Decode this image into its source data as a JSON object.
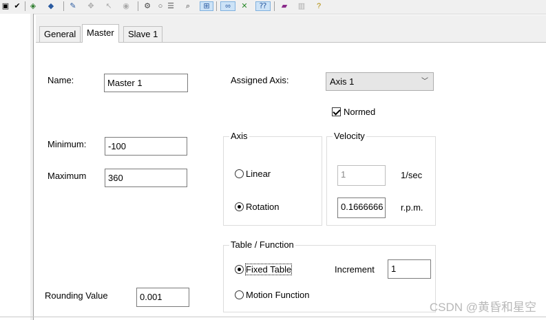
{
  "toolbar": {
    "icons": [
      "window-icon",
      "check-icon",
      "select-icon",
      "transform-icon",
      "edit-icon",
      "move-icon",
      "pointer-icon",
      "circle-icon",
      "node-icon",
      "zoom-icon",
      "network-icon",
      "list-icon",
      "view-icon",
      "axis-icon",
      "help-icon",
      "book-icon",
      "tools-icon",
      "info-icon"
    ]
  },
  "tabs": [
    "General",
    "Master",
    "Slave 1"
  ],
  "active_tab": "Master",
  "form": {
    "name_label": "Name:",
    "name_value": "Master 1",
    "minimum_label": "Minimum:",
    "minimum_value": "-100",
    "maximum_label": "Maximum",
    "maximum_value": "360",
    "rounding_label": "Rounding Value",
    "rounding_value": "0.001",
    "assigned_axis_label": "Assigned Axis:",
    "assigned_axis_value": "Axis 1",
    "normed_label": "Normed",
    "normed_checked": true
  },
  "axis_group": {
    "title": "Axis",
    "options": [
      "Linear",
      "Rotation"
    ],
    "selected": "Rotation"
  },
  "velocity_group": {
    "title": "Velocity",
    "value_sec": "1",
    "unit_sec": "1/sec",
    "value_rpm": "0.1666666",
    "unit_rpm": "r.p.m."
  },
  "table_group": {
    "title": "Table / Function",
    "options": [
      "Fixed Table",
      "Motion Function"
    ],
    "selected": "Fixed Table",
    "increment_label": "Increment",
    "increment_value": "1"
  },
  "watermark": "CSDN @黄昏和星空"
}
